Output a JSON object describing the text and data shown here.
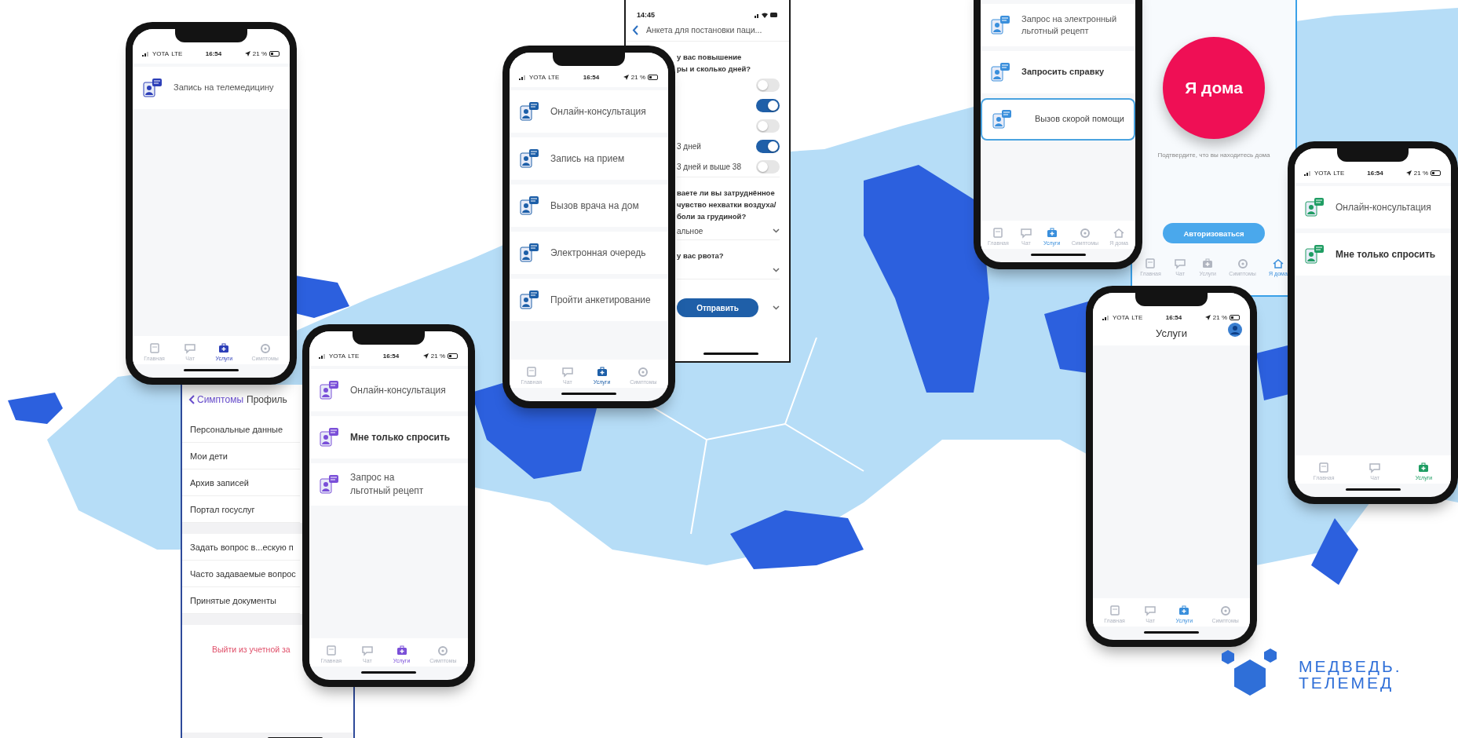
{
  "phones": [
    {
      "status": {
        "carrier": "YOTA",
        "network": "LTE",
        "time": "16:54",
        "battery": "21 %"
      },
      "items": [
        {
          "label": "Запись на телемедицину",
          "bold": false
        }
      ],
      "tabs": [
        {
          "label": "Главная",
          "selected": false
        },
        {
          "label": "Чат",
          "selected": false
        },
        {
          "label": "Услуги",
          "selected": true
        },
        {
          "label": "Симптомы",
          "selected": false
        }
      ]
    },
    {
      "status": {
        "carrier": "YOTA",
        "network": "LTE",
        "time": "16:54",
        "battery": "21 %"
      },
      "items": [
        {
          "label": "Онлайн-консультация",
          "bold": false
        },
        {
          "label": "Мне только спросить",
          "bold": true
        },
        {
          "label": "Запрос на\nльготный рецепт",
          "bold": false
        }
      ],
      "tabs": [
        {
          "label": "Главная",
          "selected": false
        },
        {
          "label": "Чат",
          "selected": false
        },
        {
          "label": "Услуги",
          "selected": true
        },
        {
          "label": "Симптомы",
          "selected": false
        }
      ]
    },
    {
      "status": {
        "carrier": "YOTA",
        "network": "LTE",
        "time": "16:54",
        "battery": "21 %"
      },
      "items": [
        {
          "label": "Онлайн-консультация",
          "bold": false
        },
        {
          "label": "Запись на прием",
          "bold": false
        },
        {
          "label": "Вызов врача на дом",
          "bold": false
        },
        {
          "label": "Электронная очередь",
          "bold": false
        },
        {
          "label": "Пройти анкетирование",
          "bold": false
        }
      ],
      "tabs": [
        {
          "label": "Главная",
          "selected": false
        },
        {
          "label": "Чат",
          "selected": false
        },
        {
          "label": "Услуги",
          "selected": true
        },
        {
          "label": "Симптомы",
          "selected": false
        }
      ]
    },
    {
      "items": [
        {
          "label": "Запрос на электронный\nльготный рецепт",
          "bold": false,
          "selected": false
        },
        {
          "label": "Запросить справку",
          "bold": true,
          "selected": false
        },
        {
          "label": "Вызов скорой помощи",
          "bold": false,
          "selected": true
        }
      ],
      "tabs": [
        {
          "label": "Главная",
          "selected": false
        },
        {
          "label": "Чат",
          "selected": false
        },
        {
          "label": "Услуги",
          "selected": true
        },
        {
          "label": "Симптомы",
          "selected": false
        },
        {
          "label": "Я дома",
          "selected": false
        }
      ]
    },
    {
      "status": {
        "carrier": "YOTA",
        "network": "LTE",
        "time": "16:54",
        "battery": "21 %"
      },
      "title": "Услуги",
      "tabs": [
        {
          "label": "Главная",
          "selected": false
        },
        {
          "label": "Чат",
          "selected": false
        },
        {
          "label": "Услуги",
          "selected": true
        },
        {
          "label": "Симптомы",
          "selected": false
        }
      ]
    },
    {
      "status": {
        "carrier": "YOTA",
        "network": "LTE",
        "time": "16:54",
        "battery": "21 %"
      },
      "items": [
        {
          "label": "Онлайн-консультация",
          "bold": false
        },
        {
          "label": "Мне только спросить",
          "bold": true
        }
      ],
      "tabs": [
        {
          "label": "Главная",
          "selected": false
        },
        {
          "label": "Чат",
          "selected": false
        },
        {
          "label": "Услуги",
          "selected": true
        }
      ]
    }
  ],
  "profile": {
    "back": "Симптомы",
    "title": "Профиль",
    "groups": [
      {
        "items": [
          "Персональные данные",
          "Мои дети",
          "Архив записей",
          "Портал госуслуг"
        ]
      },
      {
        "items": [
          "Задать вопрос в...ескую п",
          "Часто задаваемые вопрос",
          "Принятые документы"
        ]
      }
    ],
    "logout": "Выйти из учетной за"
  },
  "questionnaire": {
    "time": "14:45",
    "title": "Анкета для постановки паци...",
    "questions": [
      {
        "kind": "toggles",
        "lines": [
          "у вас повышение",
          "ры и сколько дней?"
        ],
        "options": [
          {
            "on": false
          },
          {
            "on": true
          },
          {
            "on": false
          },
          {
            "label": "3 дней",
            "on": true
          },
          {
            "label": "3 дней и выше 38",
            "on": false
          }
        ]
      },
      {
        "kind": "select",
        "lines": [
          "ваете ли вы затруднённое",
          "чувство нехватки воздуха/",
          "боли за грудиной?"
        ],
        "value": "альное"
      },
      {
        "kind": "select",
        "lines": [
          "у вас рвота?"
        ]
      }
    ],
    "submit": "Отправить"
  },
  "home_check": {
    "button": "Я дома",
    "hint": "Подтвердите, что вы находитесь дома",
    "action": "Авторизоваться",
    "tabs": [
      {
        "label": "Главная",
        "selected": false
      },
      {
        "label": "Чат",
        "selected": false
      },
      {
        "label": "Услуги",
        "selected": false
      },
      {
        "label": "Симптомы",
        "selected": false
      },
      {
        "label": "Я дома",
        "selected": true
      }
    ]
  },
  "logo": {
    "lines": [
      "МЕДВЕДЬ.",
      "ТЕЛЕМЕД"
    ]
  }
}
